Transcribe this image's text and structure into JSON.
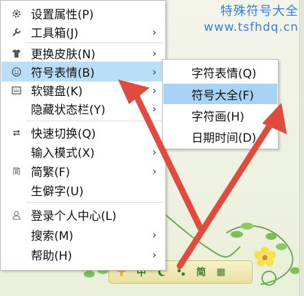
{
  "watermark": {
    "line1": "特殊符号大全",
    "line2": "www.tsfhdq.cn"
  },
  "menu": {
    "items": [
      {
        "label": "设置属性(P)",
        "icon": "gear-icon",
        "arrow": false
      },
      {
        "label": "工具箱(J)",
        "icon": "wrench-icon",
        "arrow": true
      },
      {
        "label": "更换皮肤(N)",
        "icon": "shirt-icon",
        "arrow": true
      },
      {
        "label": "符号表情(B)",
        "icon": "smiley-icon",
        "arrow": true,
        "selected": true
      },
      {
        "label": "软键盘(K)",
        "icon": "keyboard-icon",
        "arrow": true
      },
      {
        "label": "隐藏状态栏(Y)",
        "icon": "",
        "arrow": true
      },
      {
        "label": "快速切换(Q)",
        "icon": "switch-icon",
        "arrow": true
      },
      {
        "label": "输入模式(X)",
        "icon": "",
        "arrow": true
      },
      {
        "label": "简繁(F)",
        "icon": "simplified-icon",
        "icon_text": "简",
        "arrow": true
      },
      {
        "label": "生僻字(U)",
        "icon": "",
        "arrow": false
      },
      {
        "label": "登录个人中心(L)",
        "icon": "user-icon",
        "arrow": false
      },
      {
        "label": "搜索(M)",
        "icon": "",
        "arrow": true
      },
      {
        "label": "帮助(H)",
        "icon": "",
        "arrow": true
      }
    ]
  },
  "submenu": {
    "items": [
      {
        "label": "字符表情(Q)"
      },
      {
        "label": "符号大全(F)",
        "selected": true
      },
      {
        "label": "字符画(H)"
      },
      {
        "label": "日期时间(D)"
      }
    ]
  },
  "toolbar": {
    "buttons": [
      {
        "icon": "logo-icon"
      },
      {
        "icon": "chinese-mode-icon",
        "text": "中"
      },
      {
        "icon": "moon-icon"
      },
      {
        "icon": "punctuation-icon"
      },
      {
        "icon": "simplified-icon",
        "text": "简"
      },
      {
        "icon": "keyboard-icon",
        "text": "▦"
      }
    ]
  },
  "colors": {
    "selection": "#b9def7",
    "arrow": "#e04a3f",
    "watermark": "#3b7be0"
  }
}
